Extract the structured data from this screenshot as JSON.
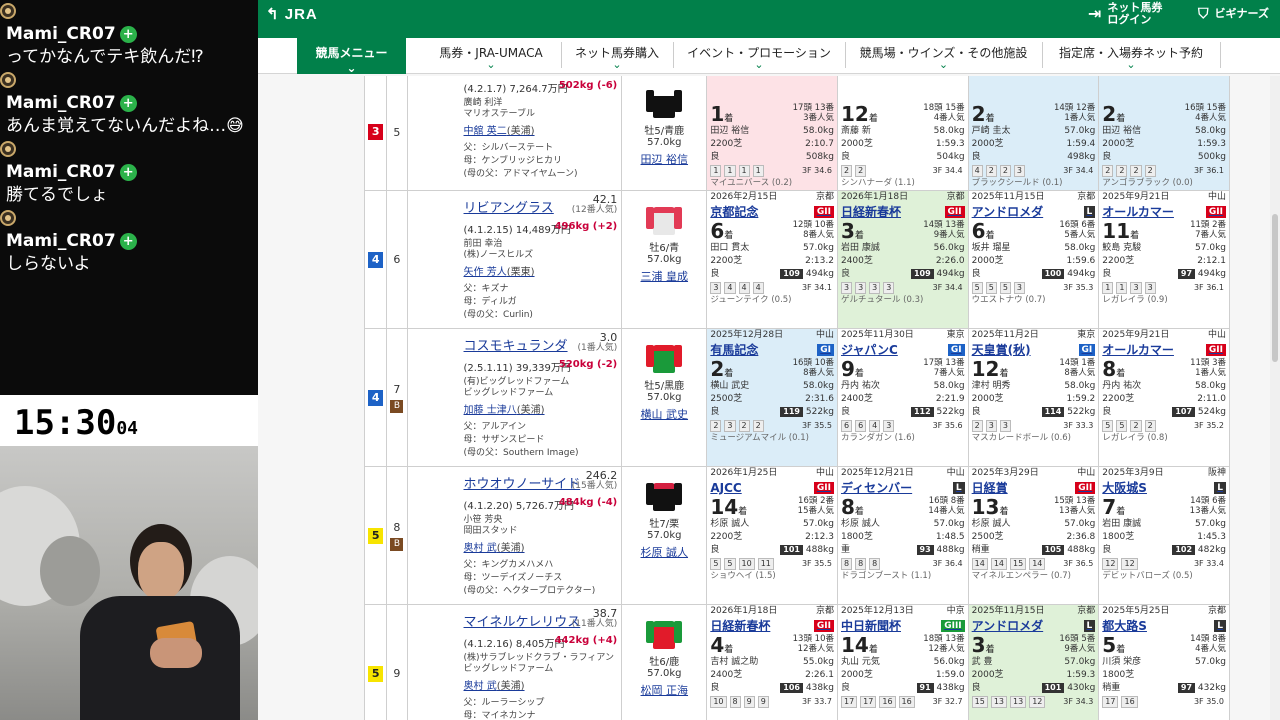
{
  "chat": {
    "messages": [
      {
        "user": "Mami_CR07",
        "text": "ってかなんでテキ飲んだ⁉"
      },
      {
        "user": "Mami_CR07",
        "text": "あんま覚えてないんだよね…😅"
      },
      {
        "user": "Mami_CR07",
        "text": "勝てるでしょ"
      },
      {
        "user": "Mami_CR07",
        "text": "しらないよ"
      }
    ]
  },
  "clock": {
    "main": "15:30",
    "sec": "04"
  },
  "site": {
    "logo": "JRA",
    "netbet": "ネット馬券\nログイン",
    "beginner": "ビギナーズ"
  },
  "nav": {
    "menu": "競馬メニュー",
    "items": [
      "馬券・JRA-UMACA",
      "ネット馬券購入",
      "イベント・プロモーション",
      "競馬場・ウインズ・その他施設",
      "指定席・入場券ネット予約"
    ]
  },
  "rows": [
    {
      "waku": "3",
      "waku_color": "#d7001a",
      "waku_text": "#ffffff",
      "uma": "5",
      "name": "",
      "odds": "",
      "ninki": "",
      "line1": "(4.2.1.7) 7,264.7万円",
      "weight": "502kg (-6)",
      "owner": [
        "廣崎 利洋",
        "マリオステーブル"
      ],
      "trainer": "中舘 英二",
      "trainer_area": "(美浦)",
      "sire": "父：シルバーステート",
      "dam": "母：ケンブリッジヒカリ",
      "damsire": "(母の父：アドマイヤムーン)",
      "sex": "牡5/青鹿",
      "kinryo": "57.0kg",
      "jockey": "田辺 裕信",
      "silk": {
        "body": "#111111",
        "arm": "#111111",
        "accent": "#ffffff"
      },
      "races": [
        {
          "bg": "pink",
          "date": "",
          "place": "",
          "rname": "",
          "grade": "",
          "gcol": "#d7001a",
          "place_no": "1",
          "field": "17頭 13番\n3番人気",
          "jockey": "田辺 裕信",
          "kg": "58.0kg",
          "dist": "2200芝",
          "time": "2:10.7",
          "cond": "良",
          "ti": "",
          "bw": "508kg",
          "pos": [
            "1",
            "1",
            "1",
            "1"
          ],
          "f3": "3F 34.6",
          "winner": "マイユニバース (0.2)"
        },
        {
          "bg": "",
          "date": "",
          "place": "",
          "rname": "",
          "grade": "",
          "gcol": "#d7001a",
          "place_no": "12",
          "field": "18頭 15番\n4番人気",
          "jockey": "斎藤 新",
          "kg": "58.0kg",
          "dist": "2000芝",
          "time": "1:59.3",
          "cond": "良",
          "ti": "",
          "bw": "504kg",
          "pos": [
            "2",
            "2"
          ],
          "f3": "3F 34.4",
          "winner": "シンハナーダ (1.1)"
        },
        {
          "bg": "blue",
          "date": "",
          "place": "",
          "rname": "",
          "grade": "",
          "gcol": "#d7001a",
          "place_no": "2",
          "field": "14頭 12番\n1番人気",
          "jockey": "戸崎 圭太",
          "kg": "57.0kg",
          "dist": "2000芝",
          "time": "1:59.4",
          "cond": "良",
          "ti": "",
          "bw": "498kg",
          "pos": [
            "4",
            "2",
            "2",
            "3"
          ],
          "f3": "3F 34.4",
          "winner": "ブラックシールド (0.1)"
        },
        {
          "bg": "blue",
          "date": "",
          "place": "",
          "rname": "",
          "grade": "",
          "gcol": "#d7001a",
          "place_no": "2",
          "field": "16頭 15番\n4番人気",
          "jockey": "田辺 裕信",
          "kg": "58.0kg",
          "dist": "2000芝",
          "time": "1:59.3",
          "cond": "良",
          "ti": "",
          "bw": "500kg",
          "pos": [
            "2",
            "2",
            "2",
            "2"
          ],
          "f3": "3F 36.1",
          "winner": "アンゴラブラック (0.0)"
        }
      ]
    },
    {
      "waku": "4",
      "waku_color": "#1d62c6",
      "waku_text": "#ffffff",
      "uma": "6",
      "name": "リビアングラス",
      "odds": "42.1",
      "ninki": "(12番人気)",
      "line1": "(4.1.2.15) 14,489万円",
      "weight": "496kg (+2)",
      "owner": [
        "前田 幸治",
        "(株)ノースヒルズ"
      ],
      "trainer": "矢作 芳人",
      "trainer_area": "(栗東)",
      "sire": "父：キズナ",
      "dam": "母：ディルガ",
      "damsire": "(母の父：Curlin)",
      "sex": "牡6/青",
      "kinryo": "57.0kg",
      "jockey": "三浦 皇成",
      "silk": {
        "body": "#e8e8e8",
        "arm": "#e23a55",
        "accent": "#e23a55"
      },
      "races": [
        {
          "bg": "",
          "date": "2026年2月15日",
          "place": "京都",
          "rname": "京都記念",
          "grade": "GII",
          "gcol": "#d7001a",
          "place_no": "6",
          "field": "12頭 10番\n8番人気",
          "jockey": "田口 貫太",
          "kg": "57.0kg",
          "dist": "2200芝",
          "time": "2:13.2",
          "cond": "良",
          "ti": "109",
          "bw": "494kg",
          "pos": [
            "3",
            "4",
            "4",
            "4"
          ],
          "f3": "3F 34.1",
          "winner": "ジューンテイク (0.5)"
        },
        {
          "bg": "green",
          "date": "2026年1月18日",
          "place": "京都",
          "rname": "日経新春杯",
          "grade": "GII",
          "gcol": "#d7001a",
          "place_no": "3",
          "field": "14頭 13番\n9番人気",
          "jockey": "岩田 康誠",
          "kg": "56.0kg",
          "dist": "2400芝",
          "time": "2:26.0",
          "cond": "良",
          "ti": "109",
          "bw": "494kg",
          "pos": [
            "3",
            "3",
            "3",
            "3"
          ],
          "f3": "3F 34.4",
          "winner": "ゲルチュタール (0.3)"
        },
        {
          "bg": "",
          "date": "2025年11月15日",
          "place": "京都",
          "rname": "アンドロメダ",
          "grade": "L",
          "gcol": "#333333",
          "place_no": "6",
          "field": "16頭 6番\n5番人気",
          "jockey": "坂井 瑠星",
          "kg": "58.0kg",
          "dist": "2000芝",
          "time": "1:59.6",
          "cond": "良",
          "ti": "100",
          "bw": "494kg",
          "pos": [
            "5",
            "5",
            "5",
            "3"
          ],
          "f3": "3F 35.3",
          "winner": "ウエストナウ (0.7)"
        },
        {
          "bg": "",
          "date": "2025年9月21日",
          "place": "中山",
          "rname": "オールカマー",
          "grade": "GII",
          "gcol": "#d7001a",
          "place_no": "11",
          "field": "11頭 2番\n7番人気",
          "jockey": "鮫島 克駿",
          "kg": "57.0kg",
          "dist": "2200芝",
          "time": "2:12.1",
          "cond": "良",
          "ti": "97",
          "bw": "494kg",
          "pos": [
            "1",
            "1",
            "3",
            "3"
          ],
          "f3": "3F 36.1",
          "winner": "レガレイラ (0.9)"
        }
      ]
    },
    {
      "waku": "4",
      "waku_color": "#1d62c6",
      "waku_text": "#ffffff",
      "uma": "7",
      "blinker": "B",
      "name": "コスモキュランダ",
      "odds": "3.0",
      "ninki": "(1番人気)",
      "line1": "(2.5.1.11) 39,339万円",
      "weight": "520kg (-2)",
      "owner": [
        "(有)ビッグレッドファーム",
        "ビッグレッドファーム"
      ],
      "trainer": "加藤 士津八",
      "trainer_area": "(美浦)",
      "sire": "父：アルアイン",
      "dam": "母：サザンスピード",
      "damsire": "(母の父：Southern Image)",
      "sex": "牡5/黒鹿",
      "kinryo": "57.0kg",
      "jockey": "横山 武史",
      "silk": {
        "body": "#1a9a3a",
        "arm": "#e11b2a",
        "accent": "#e11b2a"
      },
      "races": [
        {
          "bg": "blue",
          "date": "2025年12月28日",
          "place": "中山",
          "rname": "有馬記念",
          "grade": "GI",
          "gcol": "#1d62c6",
          "place_no": "2",
          "field": "16頭 10番\n8番人気",
          "jockey": "横山 武史",
          "kg": "58.0kg",
          "dist": "2500芝",
          "time": "2:31.6",
          "cond": "良",
          "ti": "119",
          "bw": "522kg",
          "pos": [
            "2",
            "3",
            "2",
            "2"
          ],
          "f3": "3F 35.5",
          "winner": "ミュージアムマイル (0.1)"
        },
        {
          "bg": "",
          "date": "2025年11月30日",
          "place": "東京",
          "rname": "ジャパンC",
          "grade": "GI",
          "gcol": "#1d62c6",
          "place_no": "9",
          "field": "17頭 13番\n7番人気",
          "jockey": "丹内 祐次",
          "kg": "58.0kg",
          "dist": "2400芝",
          "time": "2:21.9",
          "cond": "良",
          "ti": "112",
          "bw": "522kg",
          "pos": [
            "6",
            "6",
            "4",
            "3"
          ],
          "f3": "3F 35.6",
          "winner": "カランダガン (1.6)"
        },
        {
          "bg": "",
          "date": "2025年11月2日",
          "place": "東京",
          "rname": "天皇賞(秋)",
          "grade": "GI",
          "gcol": "#1d62c6",
          "place_no": "12",
          "field": "14頭 1番\n8番人気",
          "jockey": "津村 明秀",
          "kg": "58.0kg",
          "dist": "2000芝",
          "time": "1:59.2",
          "cond": "良",
          "ti": "114",
          "bw": "522kg",
          "pos": [
            "2",
            "3",
            "3"
          ],
          "f3": "3F 33.3",
          "winner": "マスカレードボール (0.6)"
        },
        {
          "bg": "",
          "date": "2025年9月21日",
          "place": "中山",
          "rname": "オールカマー",
          "grade": "GII",
          "gcol": "#d7001a",
          "place_no": "8",
          "field": "11頭 3番\n1番人気",
          "jockey": "丹内 祐次",
          "kg": "58.0kg",
          "dist": "2200芝",
          "time": "2:11.0",
          "cond": "良",
          "ti": "107",
          "bw": "524kg",
          "pos": [
            "5",
            "5",
            "2",
            "2"
          ],
          "f3": "3F 35.2",
          "winner": "レガレイラ (0.8)"
        }
      ]
    },
    {
      "waku": "5",
      "waku_color": "#f7e400",
      "waku_text": "#222222",
      "uma": "8",
      "blinker": "B",
      "name": "ホウオウノーサイド",
      "odds": "246.2",
      "ninki": "(15番人気)",
      "line1": "(4.1.2.20) 5,726.7万円",
      "weight": "484kg (-4)",
      "owner": [
        "小笹 芳央",
        "岡田スタッド"
      ],
      "trainer": "奥村 武",
      "trainer_area": "(美浦)",
      "sire": "父：キングカメハメハ",
      "dam": "母：ツーデイズノーチス",
      "damsire": "(母の父：ヘクタープロテクター)",
      "sex": "牡7/栗",
      "kinryo": "57.0kg",
      "jockey": "杉原 誠人",
      "silk": {
        "body": "#111111",
        "arm": "#111111",
        "accent": "#d32040"
      },
      "races": [
        {
          "bg": "",
          "date": "2026年1月25日",
          "place": "中山",
          "rname": "AJCC",
          "grade": "GII",
          "gcol": "#d7001a",
          "place_no": "14",
          "field": "16頭 2番\n15番人気",
          "jockey": "杉原 誠人",
          "kg": "57.0kg",
          "dist": "2200芝",
          "time": "2:12.3",
          "cond": "良",
          "ti": "101",
          "bw": "488kg",
          "pos": [
            "5",
            "5",
            "10",
            "11"
          ],
          "f3": "3F 35.5",
          "winner": "ショウヘイ (1.5)"
        },
        {
          "bg": "",
          "date": "2025年12月21日",
          "place": "中山",
          "rname": "ディセンバー",
          "grade": "L",
          "gcol": "#333333",
          "place_no": "8",
          "field": "16頭 8番\n14番人気",
          "jockey": "杉原 誠人",
          "kg": "57.0kg",
          "dist": "1800芝",
          "time": "1:48.5",
          "cond": "重",
          "ti": "93",
          "bw": "488kg",
          "pos": [
            "8",
            "8",
            "8"
          ],
          "f3": "3F 36.4",
          "winner": "ドラゴンブースト (1.1)"
        },
        {
          "bg": "",
          "date": "2025年3月29日",
          "place": "中山",
          "rname": "日経賞",
          "grade": "GII",
          "gcol": "#d7001a",
          "place_no": "13",
          "field": "15頭 13番\n13番人気",
          "jockey": "杉原 誠人",
          "kg": "57.0kg",
          "dist": "2500芝",
          "time": "2:36.8",
          "cond": "稍重",
          "ti": "105",
          "bw": "488kg",
          "pos": [
            "14",
            "14",
            "15",
            "14"
          ],
          "f3": "3F 36.5",
          "winner": "マイネルエンペラー (0.7)"
        },
        {
          "bg": "",
          "date": "2025年3月9日",
          "place": "阪神",
          "rname": "大阪城S",
          "grade": "L",
          "gcol": "#333333",
          "place_no": "7",
          "field": "14頭 6番\n13番人気",
          "jockey": "岩田 康誠",
          "kg": "57.0kg",
          "dist": "1800芝",
          "time": "1:45.3",
          "cond": "良",
          "ti": "102",
          "bw": "482kg",
          "pos": [
            "12",
            "12"
          ],
          "f3": "3F 33.4",
          "winner": "デビットバローズ (0.5)"
        }
      ]
    },
    {
      "waku": "5",
      "waku_color": "#f7e400",
      "waku_text": "#222222",
      "uma": "9",
      "name": "マイネルケレリウス",
      "odds": "38.7",
      "ninki": "(11番人気)",
      "line1": "(4.1.2.16) 8,405万円",
      "weight": "442kg (+4)",
      "owner": [
        "(株)サラブレッドクラブ・ラフィアン",
        "ビッグレッドファーム"
      ],
      "trainer": "奥村 武",
      "trainer_area": "(美浦)",
      "sire": "父：ルーラーシップ",
      "dam": "母：マイネカンナ",
      "damsire": "",
      "sex": "牡6/鹿",
      "kinryo": "57.0kg",
      "jockey": "松岡 正海",
      "silk": {
        "body": "#e11b2a",
        "arm": "#1a9a3a",
        "accent": "#1a9a3a"
      },
      "races": [
        {
          "bg": "",
          "date": "2026年1月18日",
          "place": "京都",
          "rname": "日経新春杯",
          "grade": "GII",
          "gcol": "#d7001a",
          "place_no": "4",
          "field": "13頭 10番\n12番人気",
          "jockey": "吉村 誠之助",
          "kg": "55.0kg",
          "dist": "2400芝",
          "time": "2:26.1",
          "cond": "良",
          "ti": "106",
          "bw": "438kg",
          "pos": [
            "10",
            "8",
            "9",
            "9"
          ],
          "f3": "3F 33.7",
          "winner": ""
        },
        {
          "bg": "",
          "date": "2025年12月13日",
          "place": "中京",
          "rname": "中日新聞杯",
          "grade": "GIII",
          "gcol": "#1a9a3a",
          "place_no": "14",
          "field": "18頭 13番\n12番人気",
          "jockey": "丸山 元気",
          "kg": "56.0kg",
          "dist": "2000芝",
          "time": "1:59.0",
          "cond": "良",
          "ti": "91",
          "bw": "438kg",
          "pos": [
            "17",
            "17",
            "16",
            "16"
          ],
          "f3": "3F 32.7",
          "winner": ""
        },
        {
          "bg": "green",
          "date": "2025年11月15日",
          "place": "京都",
          "rname": "アンドロメダ",
          "grade": "L",
          "gcol": "#333333",
          "place_no": "3",
          "field": "16頭 5番\n9番人気",
          "jockey": "武 豊",
          "kg": "57.0kg",
          "dist": "2000芝",
          "time": "1:59.3",
          "cond": "良",
          "ti": "101",
          "bw": "430kg",
          "pos": [
            "15",
            "13",
            "13",
            "12"
          ],
          "f3": "3F 34.3",
          "winner": ""
        },
        {
          "bg": "",
          "date": "2025年5月25日",
          "place": "京都",
          "rname": "都大路S",
          "grade": "L",
          "gcol": "#333333",
          "place_no": "5",
          "field": "14頭 8番\n4番人気",
          "jockey": "川須 栄彦",
          "kg": "57.0kg",
          "dist": "1800芝",
          "time": "",
          "cond": "稍重",
          "ti": "97",
          "bw": "432kg",
          "pos": [
            "17",
            "16"
          ],
          "f3": "3F 35.0",
          "winner": ""
        }
      ]
    }
  ]
}
